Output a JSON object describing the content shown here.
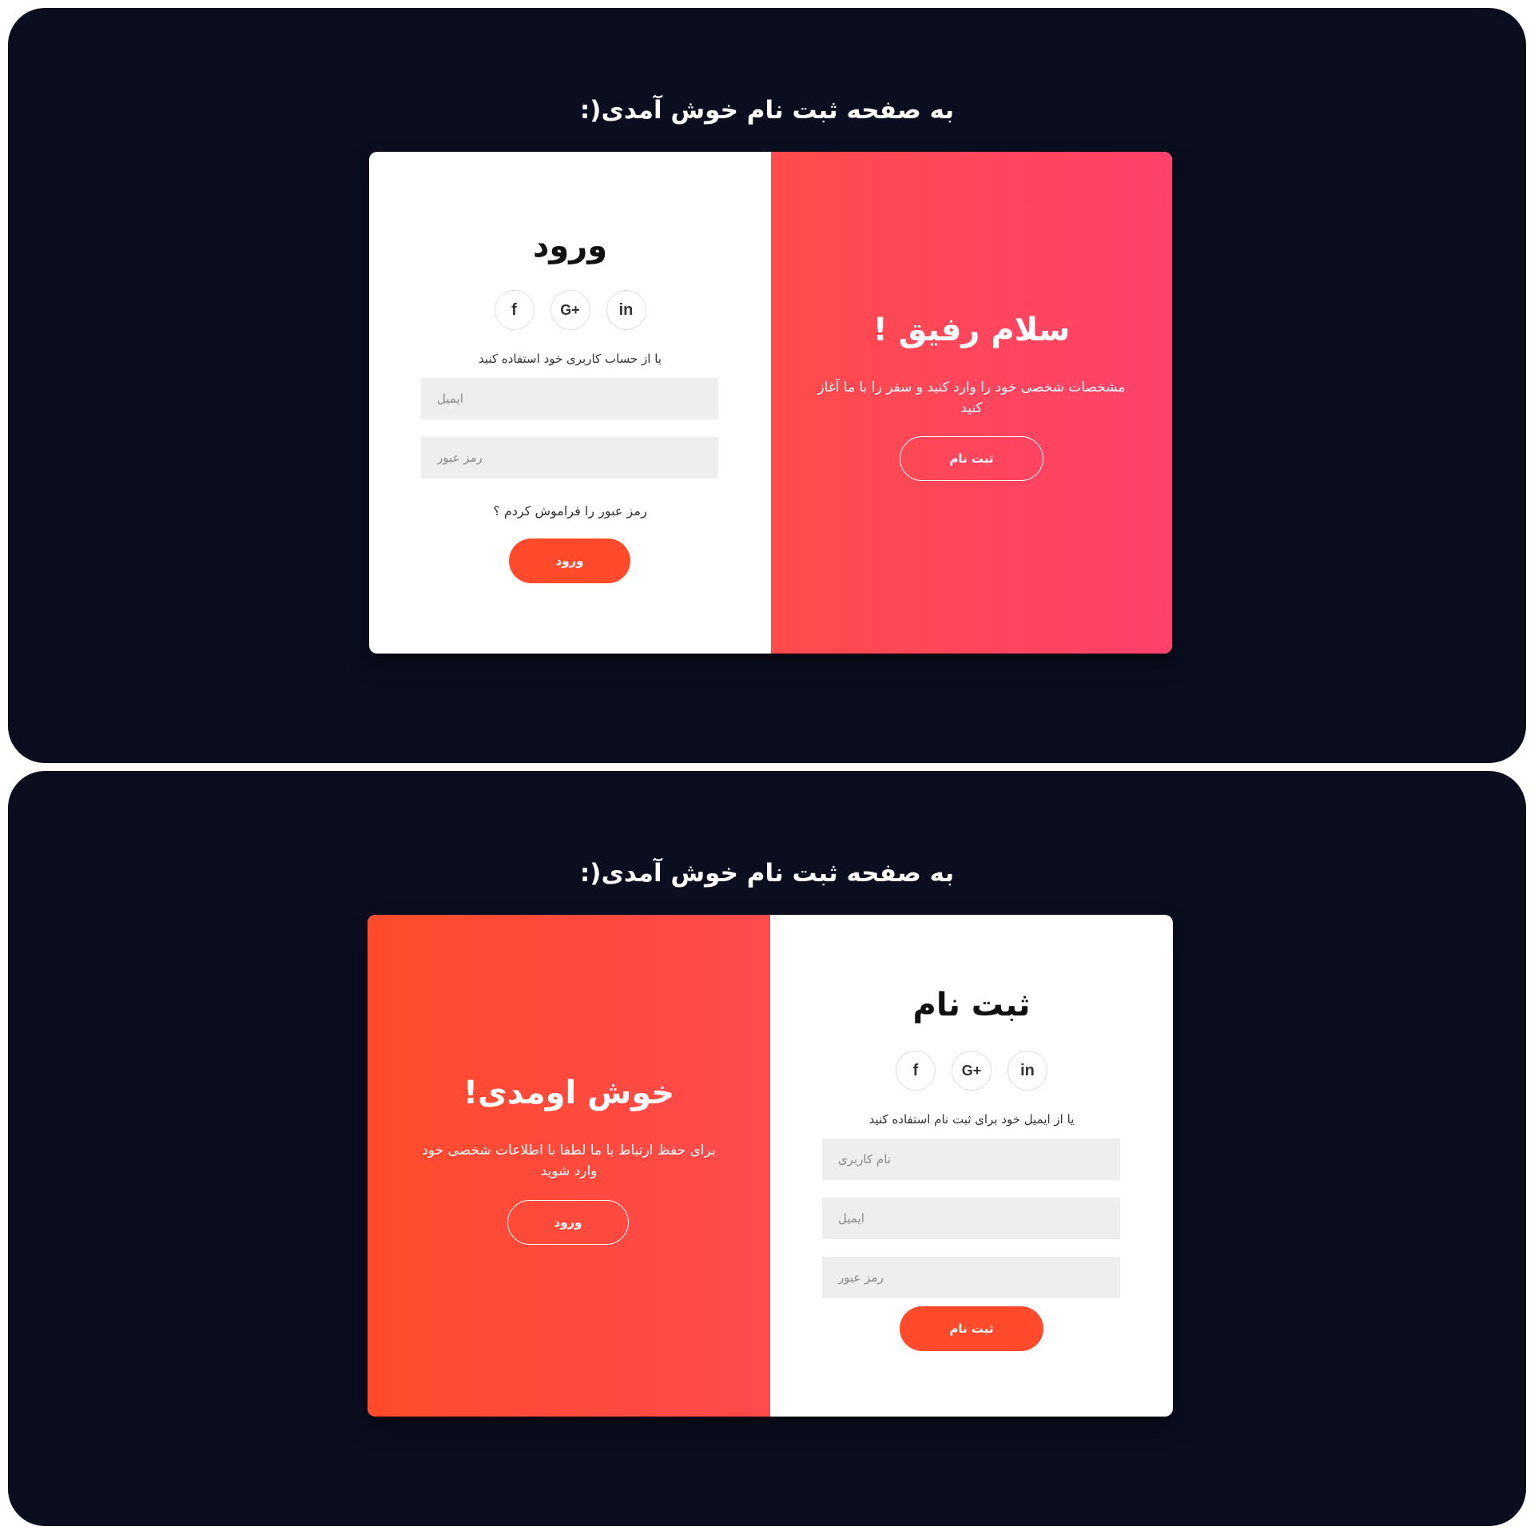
{
  "welcome_title": "به صفحه ثبت نام خوش آمدی(:",
  "colors": {
    "background": "#0b0e1f",
    "accent": "#ff4b2b",
    "overlay_pink_start": "#ff4b4b",
    "overlay_pink_end": "#ff416c",
    "overlay_orange_start": "#ff4b2b",
    "overlay_orange_end": "#ff4a4f",
    "input_bg": "#eeeeee"
  },
  "social_icons": [
    {
      "icon": "facebook-icon",
      "glyph": "f"
    },
    {
      "icon": "google-plus-icon",
      "glyph": "G+"
    },
    {
      "icon": "linkedin-icon",
      "glyph": "in"
    }
  ],
  "login_view": {
    "form": {
      "title": "ورود",
      "hint": "یا از حساب کاربری خود استفاده کنید",
      "email_placeholder": "ایمیل",
      "password_placeholder": "رمز عبور",
      "forgot_link": "رمز عبور را فراموش کردم ؟",
      "submit_label": "ورود"
    },
    "overlay": {
      "title": "سلام رفیق !",
      "text": "مشخصات شخصی خود را وارد کنید و سفر را با ما آغاز کنید",
      "button_label": "ثبت نام"
    }
  },
  "signup_view": {
    "overlay": {
      "title": "خوش اومدی!",
      "text": "برای حفظ ارتباط با ما لطفا با اطلاعات شخصی خود وارد شوید",
      "button_label": "ورود"
    },
    "form": {
      "title": "ثبت نام",
      "hint": "یا از ایمیل خود برای ثبت نام استفاده کنید",
      "username_placeholder": "نام کاربری",
      "email_placeholder": "ایمیل",
      "password_placeholder": "رمز عبور",
      "submit_label": "ثبت نام"
    }
  }
}
